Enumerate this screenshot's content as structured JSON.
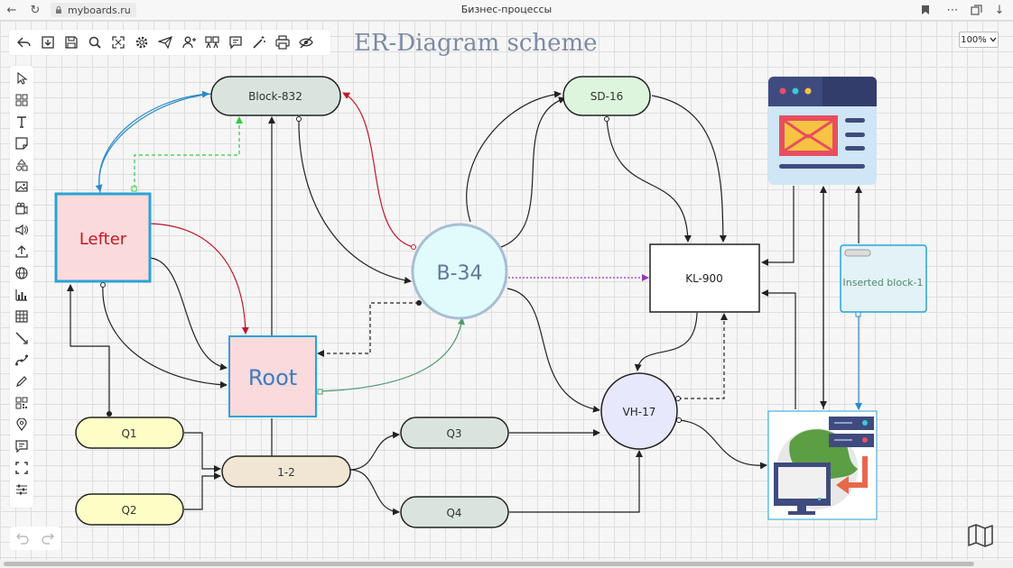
{
  "browser": {
    "url": "myboards.ru",
    "tab_title": "Бизнес-процессы"
  },
  "title": "ER-Diagram scheme",
  "zoom": {
    "value": "100%"
  },
  "toolbar_top": {
    "icons": [
      "back-arrow-icon",
      "save-file-icon",
      "floppy-save-icon",
      "search-icon",
      "fit-screen-icon",
      "gear-icon",
      "send-icon",
      "add-user-icon",
      "collaborators-icon",
      "comment-icon",
      "magic-wand-icon",
      "print-icon",
      "eye-slash-icon"
    ]
  },
  "toolbar_left": {
    "icons": [
      "cursor-icon",
      "templates-icon",
      "text-icon",
      "sticky-note-icon",
      "shapes-icon",
      "image-icon",
      "video-icon",
      "audio-icon",
      "upload-icon",
      "globe-icon",
      "chart-icon",
      "table-icon",
      "line-icon",
      "curve-icon",
      "pencil-icon",
      "qr-code-icon",
      "location-pin-icon",
      "comment-icon",
      "frame-icon",
      "settings-sliders-icon"
    ]
  },
  "nodes": {
    "block832": "Block-832",
    "sd16": "SD-16",
    "lefter": "Lefter",
    "b34": "B-34",
    "kl900": "KL-900",
    "inserted": "Inserted block-1",
    "root": "Root",
    "vh17": "VH-17",
    "q1": "Q1",
    "q2": "Q2",
    "q3": "Q3",
    "q4": "Q4",
    "n12": "1-2"
  },
  "colors": {
    "accent_blue": "#2aa3d6",
    "arrow_red": "#c0182a",
    "arrow_green": "#2ecc40",
    "arrow_purple": "#9b2fc8",
    "pink_fill": "#fbdadb"
  }
}
